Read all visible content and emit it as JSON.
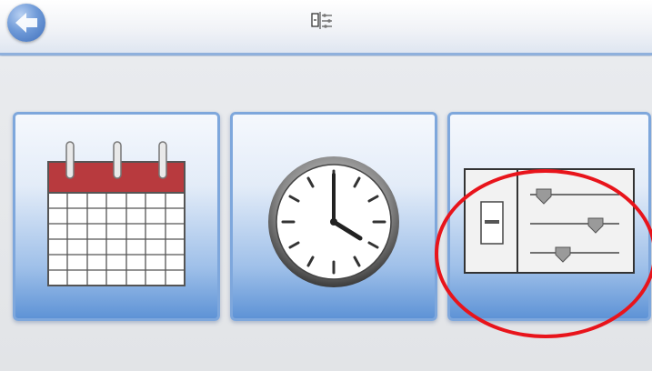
{
  "screen": {
    "accent_color": "#7ea7dc",
    "annotation_color": "#e8141b"
  },
  "header": {
    "back_icon": "back-arrow-icon",
    "title_icon": "device-settings-icon"
  },
  "tiles": [
    {
      "id": "calendar",
      "icon": "calendar-icon"
    },
    {
      "id": "clock",
      "icon": "clock-icon"
    },
    {
      "id": "settings",
      "icon": "sliders-settings-icon",
      "highlighted": true
    }
  ]
}
